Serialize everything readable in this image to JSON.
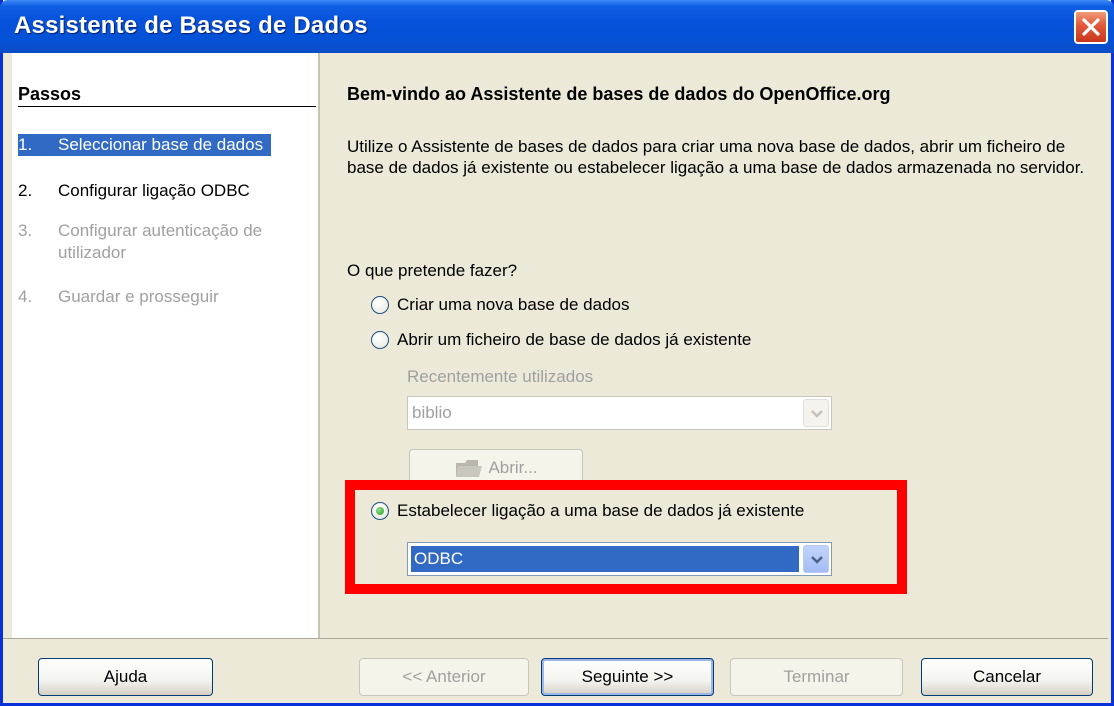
{
  "window": {
    "title": "Assistente de Bases de Dados"
  },
  "sidebar": {
    "heading": "Passos",
    "steps": [
      {
        "num": "1.",
        "label": "Seleccionar base de dados",
        "state": "active"
      },
      {
        "num": "2.",
        "label": "Configurar ligação ODBC",
        "state": "normal"
      },
      {
        "num": "3.",
        "label": "Configurar autenticação de utilizador",
        "state": "disabled"
      },
      {
        "num": "4.",
        "label": "Guardar e prosseguir",
        "state": "disabled"
      }
    ]
  },
  "main": {
    "title": "Bem-vindo ao Assistente de bases de dados do OpenOffice.org",
    "description": "Utilize o Assistente de bases de dados para criar uma nova base de dados, abrir um ficheiro de base de dados já existente ou estabelecer ligação a uma base de dados armazenada no servidor.",
    "question": "O que pretende fazer?",
    "options": {
      "create": "Criar uma nova base de dados",
      "open": "Abrir um ficheiro de base de dados já existente",
      "connect": "Estabelecer ligação a uma base de dados já existente"
    },
    "selected_option": "connect",
    "recent_label": "Recentemente utilizados",
    "recent_value": "biblio",
    "open_button": "Abrir...",
    "connection_type": "ODBC"
  },
  "footer": {
    "help": "Ajuda",
    "back": "<< Anterior",
    "next": "Seguinte >>",
    "finish": "Terminar",
    "cancel": "Cancelar"
  },
  "colors": {
    "titlebar": "#0652db",
    "selection": "#316ac5",
    "highlight": "#ff0000",
    "dialog_bg": "#ece9d8"
  }
}
